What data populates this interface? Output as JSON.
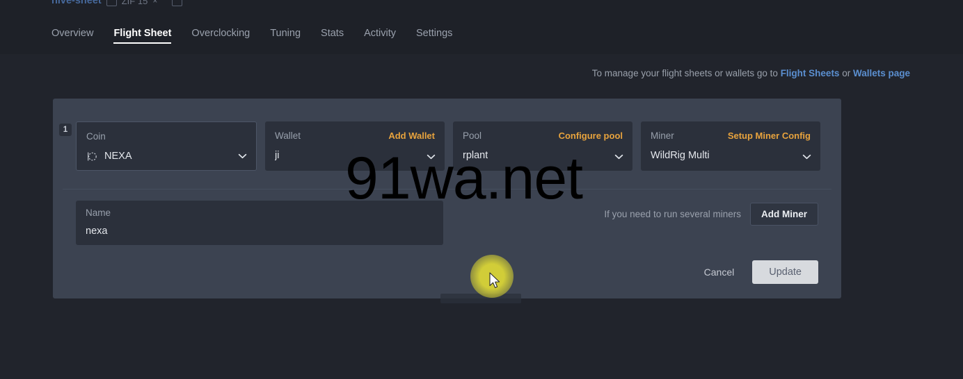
{
  "header": {
    "breadcrumb": {
      "worker_link": "hive-sheet",
      "rig_text": "ZIF 15",
      "close_label": "×",
      "edit_icon": "edit-icon",
      "chart_icon": "chart-icon"
    },
    "tabs": [
      {
        "label": "Overview",
        "active": false
      },
      {
        "label": "Flight Sheet",
        "active": true
      },
      {
        "label": "Overclocking",
        "active": false
      },
      {
        "label": "Tuning",
        "active": false
      },
      {
        "label": "Stats",
        "active": false
      },
      {
        "label": "Activity",
        "active": false
      },
      {
        "label": "Settings",
        "active": false
      }
    ]
  },
  "hint": {
    "prefix": "To manage your flight sheets or wallets go to ",
    "link1": "Flight Sheets",
    "middle": " or ",
    "link2": "Wallets page"
  },
  "flight_sheet": {
    "badge": "1",
    "fields": [
      {
        "label": "Coin",
        "action": "",
        "value": "NEXA",
        "icon": "coin-nexa-icon",
        "chevron": "chevron-down-icon"
      },
      {
        "label": "Wallet",
        "action": "Add Wallet",
        "value": "ji",
        "icon": "",
        "chevron": "chevron-down-icon"
      },
      {
        "label": "Pool",
        "action": "Configure pool",
        "value": "rplant",
        "icon": "",
        "chevron": "chevron-down-icon"
      },
      {
        "label": "Miner",
        "action": "Setup Miner Config",
        "value": "WildRig Multi",
        "icon": "",
        "chevron": "chevron-down-icon"
      }
    ],
    "name_field": {
      "label": "Name",
      "value": "nexa",
      "placeholder": "Name"
    },
    "add_miner": {
      "hint": "If you need to run several miners",
      "button": "Add Miner"
    },
    "footer": {
      "cancel": "Cancel",
      "update": "Update"
    }
  },
  "overlay": {
    "watermark": "91wa.net"
  },
  "colors": {
    "page_bg": "#21242c",
    "header_bg": "#1e2128",
    "panel_bg": "#3c4351",
    "field_bg": "#2b303b",
    "accent_orange": "#e8a33d",
    "link_blue": "#5b8fd0",
    "update_btn": "#d7dade",
    "cursor_halo": "#ded936"
  }
}
